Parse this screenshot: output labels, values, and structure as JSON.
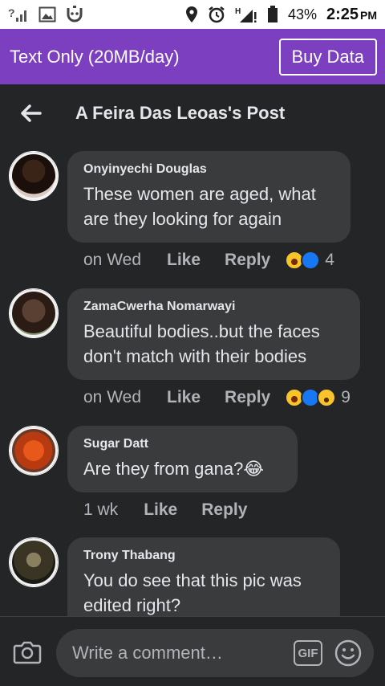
{
  "status_bar": {
    "battery": "43%",
    "time": "2:25",
    "ampm": "PM",
    "network_letter": "H"
  },
  "banner": {
    "text": "Text Only (20MB/day)",
    "button": "Buy Data"
  },
  "header": {
    "title": "A Feira Das Leoas's Post"
  },
  "comments": [
    {
      "author": "Onyinyechi Douglas",
      "text": "These women are aged, what are they looking for again",
      "time": "on Wed",
      "like": "Like",
      "reply": "Reply",
      "reaction_count": "4",
      "reactions": [
        "haha-icon",
        "like-icon"
      ]
    },
    {
      "author": "ZamaCwerha Nomarwayi",
      "text": "Beautiful bodies..but the faces don't match with their bodies",
      "time": "on Wed",
      "like": "Like",
      "reply": "Reply",
      "reaction_count": "9",
      "reactions": [
        "haha-icon",
        "like-icon",
        "wow-icon"
      ]
    },
    {
      "author": "Sugar Datt",
      "text": "Are they from gana?😂",
      "time": "1 wk",
      "like": "Like",
      "reply": "Reply"
    },
    {
      "author": "Trony Thabang",
      "text": "You do see that this pic was edited right?"
    }
  ],
  "input": {
    "placeholder": "Write a comment…",
    "gif": "GIF"
  },
  "colors": {
    "background": "#242526",
    "bubble": "#3a3b3c",
    "banner": "#7b3fbf",
    "text": "#e4e6eb",
    "muted": "#b0b3b8"
  }
}
